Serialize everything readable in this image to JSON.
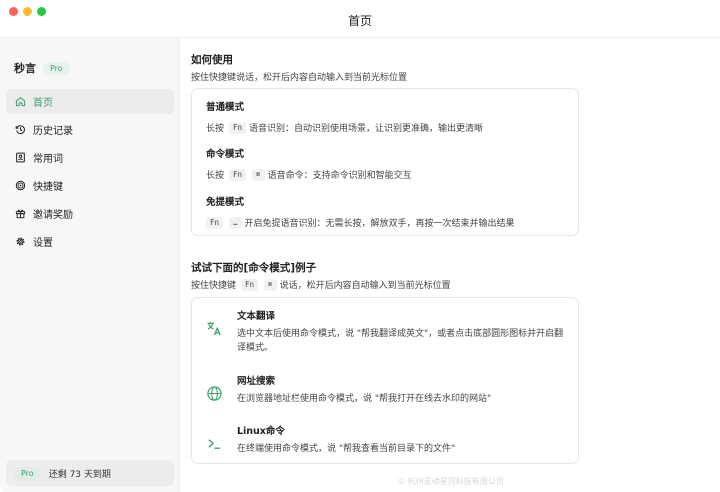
{
  "window": {
    "title": "首页"
  },
  "sidebar": {
    "app_name": "秒言",
    "pro_label": "Pro",
    "items": [
      {
        "label": "首页",
        "icon": "home-icon",
        "active": true
      },
      {
        "label": "历史记录",
        "icon": "history-icon",
        "active": false
      },
      {
        "label": "常用词",
        "icon": "vocabulary-icon",
        "active": false
      },
      {
        "label": "快捷键",
        "icon": "shortcut-icon",
        "active": false
      },
      {
        "label": "邀请奖励",
        "icon": "gift-icon",
        "active": false
      },
      {
        "label": "设置",
        "icon": "gear-icon",
        "active": false
      }
    ],
    "expiry": {
      "badge": "Pro",
      "text": "还剩 73 天到期"
    }
  },
  "usage": {
    "title": "如何使用",
    "subtitle": "按住快捷键说话，松开后内容自动输入到当前光标位置",
    "modes": [
      {
        "title": "普通模式",
        "prefix": "长按",
        "keys": [
          "Fn"
        ],
        "desc": "语音识别：自动识别使用场景，让识别更准确，输出更清晰"
      },
      {
        "title": "命令模式",
        "prefix": "长按",
        "keys": [
          "Fn",
          "⌘"
        ],
        "desc": "语音命令：支持命令识别和智能交互"
      },
      {
        "title": "免提模式",
        "prefix": "",
        "keys": [
          "Fn",
          "…"
        ],
        "desc": "开启免提语音识别：无需长按，解放双手，再按一次结束并输出结果"
      }
    ]
  },
  "examples": {
    "title": "试试下面的[命令模式]例子",
    "subtitle_prefix": "按住快捷键",
    "subtitle_keys": [
      "Fn",
      "⌘"
    ],
    "subtitle_suffix": "说话，松开后内容自动输入到当前光标位置",
    "items": [
      {
        "title": "文本翻译",
        "icon": "translate-icon",
        "desc": "选中文本后使用命令模式，说 \"帮我翻译成英文\"，或者点击底部圆形图标并开启翻译模式。"
      },
      {
        "title": "网址搜索",
        "icon": "globe-icon",
        "desc": "在浏览器地址栏使用命令模式，说 \"帮我打开在线去水印的网站\""
      },
      {
        "title": "Linux命令",
        "icon": "terminal-icon",
        "desc": "在终端使用命令模式，说 \"帮我查看当前目录下的文件\""
      }
    ]
  },
  "footer": {
    "text": "© 杭州灵动星河科技有限公司"
  },
  "colors": {
    "accent": "#3a9d6b",
    "sidebar_bg": "#f7f7f7",
    "border": "#e6e6e6"
  }
}
